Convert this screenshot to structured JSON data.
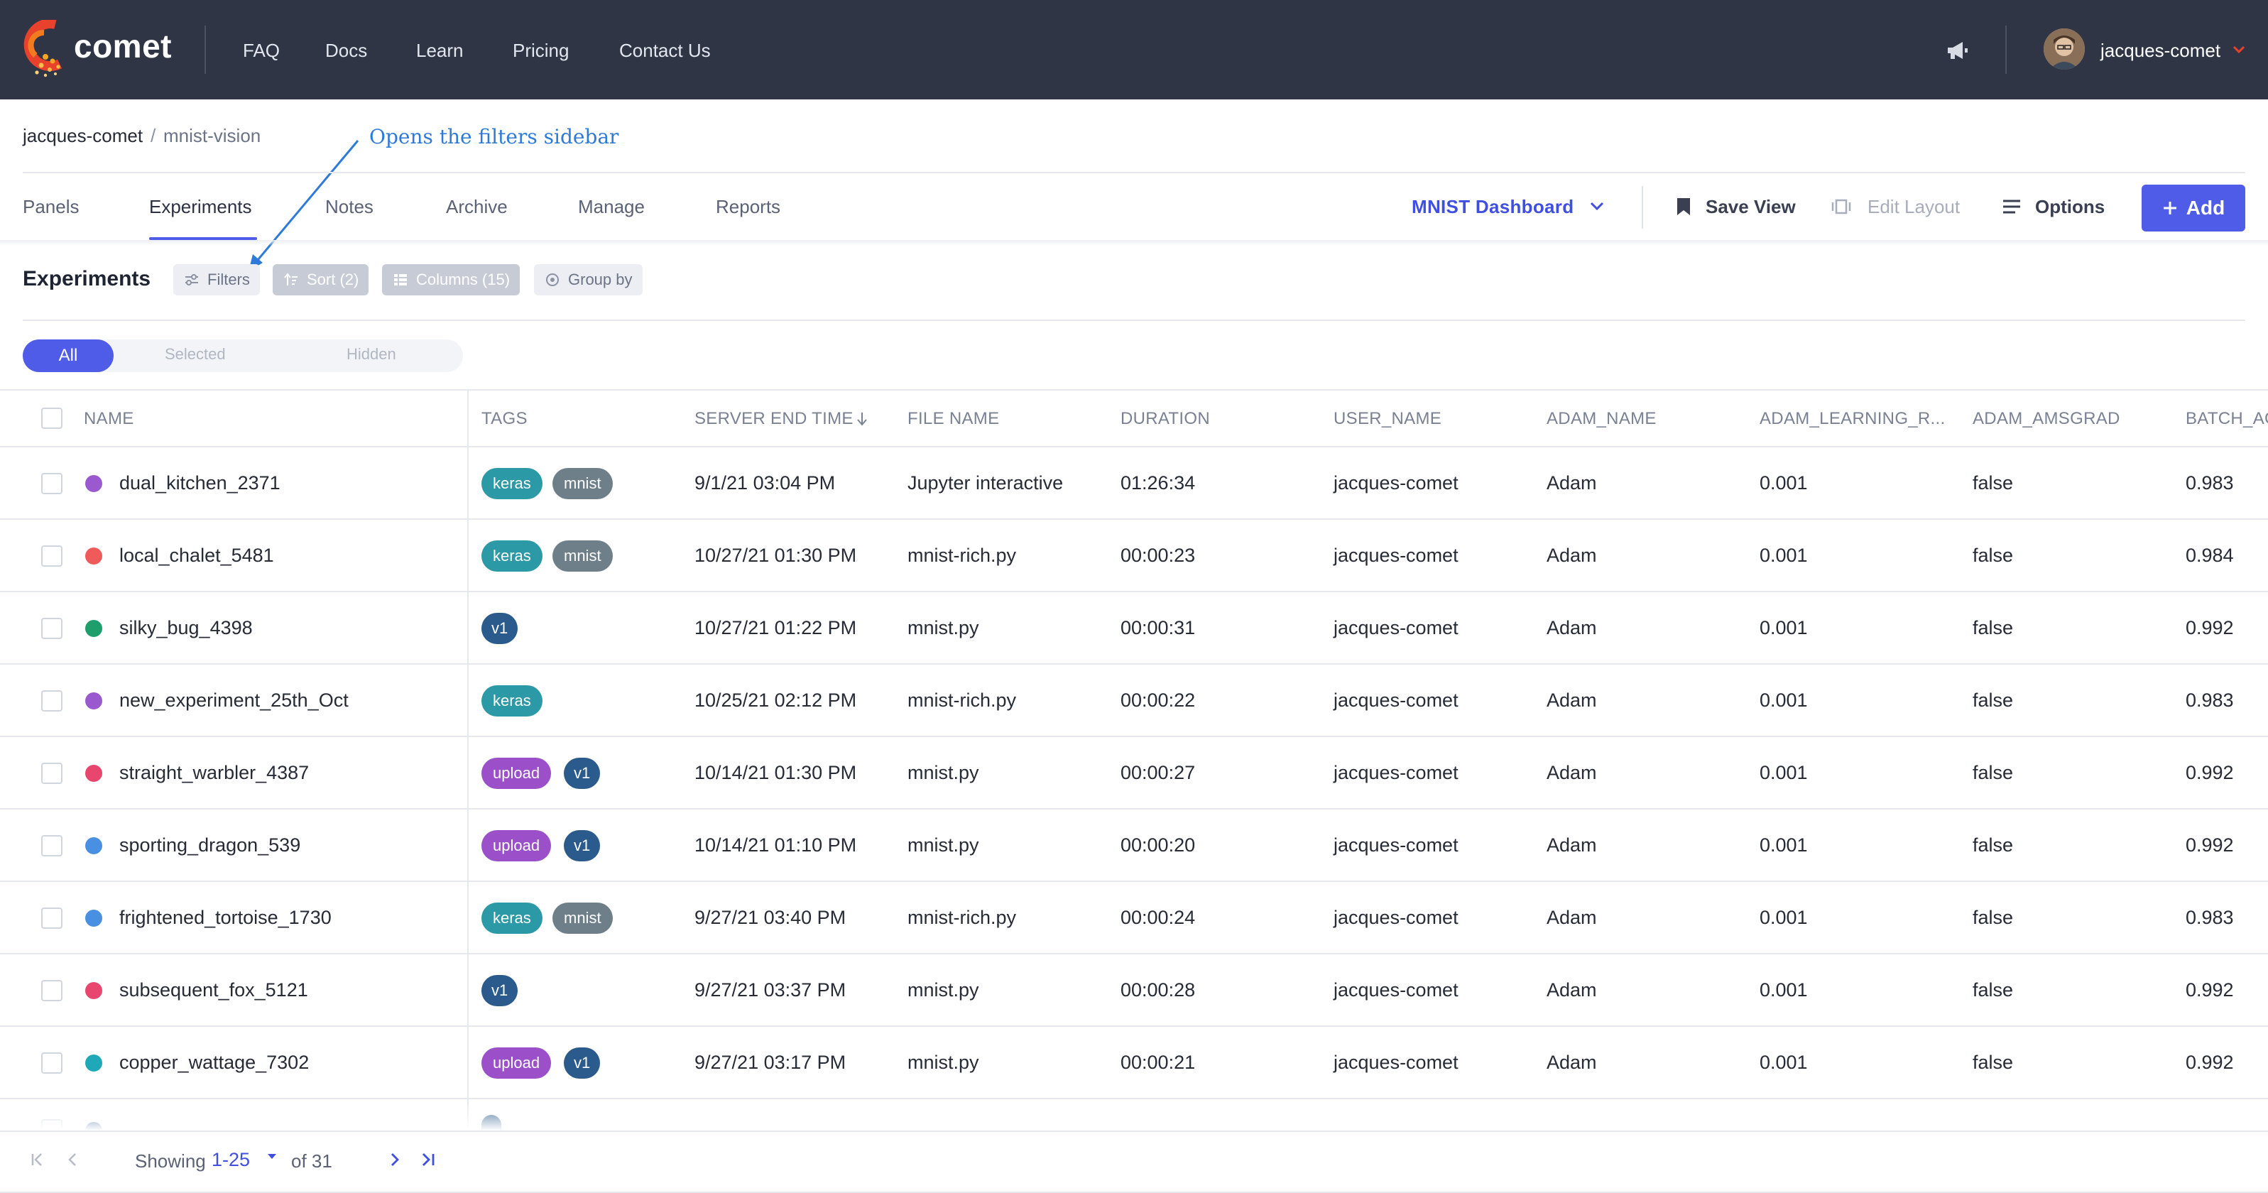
{
  "brand": {
    "name": "comet"
  },
  "nav": {
    "items": [
      "FAQ",
      "Docs",
      "Learn",
      "Pricing",
      "Contact Us"
    ]
  },
  "user": {
    "name": "jacques-comet"
  },
  "breadcrumb": {
    "owner": "jacques-comet",
    "separator": "/",
    "project": "mnist-vision"
  },
  "annotation": {
    "text": "Opens the filters sidebar"
  },
  "tabs": [
    "Panels",
    "Experiments",
    "Notes",
    "Archive",
    "Manage",
    "Reports"
  ],
  "active_tab": "Experiments",
  "toolbar": {
    "dashboard": "MNIST Dashboard",
    "save_view": "Save View",
    "edit_layout": "Edit Layout",
    "options": "Options",
    "add": "Add"
  },
  "experiments": {
    "title": "Experiments",
    "filters": "Filters",
    "sort": "Sort (2)",
    "columns": "Columns (15)",
    "group_by": "Group by"
  },
  "segments": {
    "all": "All",
    "selected": "Selected",
    "hidden": "Hidden"
  },
  "columns": [
    "NAME",
    "TAGS",
    "SERVER END TIME",
    "FILE NAME",
    "DURATION",
    "USER_NAME",
    "ADAM_NAME",
    "ADAM_LEARNING_R...",
    "ADAM_AMSGRAD",
    "BATCH_AC"
  ],
  "rows": [
    {
      "name": "dual_kitchen_2371",
      "color": "#9b59d0",
      "tags": [
        "keras",
        "mnist"
      ],
      "end_time": "9/1/21 03:04 PM",
      "file": "Jupyter interactive",
      "duration": "01:26:34",
      "user": "jacques-comet",
      "adam": "Adam",
      "lr": "0.001",
      "amsgrad": "false",
      "batch": "0.983"
    },
    {
      "name": "local_chalet_5481",
      "color": "#ef5b5b",
      "tags": [
        "keras",
        "mnist"
      ],
      "end_time": "10/27/21 01:30 PM",
      "file": "mnist-rich.py",
      "duration": "00:00:23",
      "user": "jacques-comet",
      "adam": "Adam",
      "lr": "0.001",
      "amsgrad": "false",
      "batch": "0.984"
    },
    {
      "name": "silky_bug_4398",
      "color": "#1e9e6a",
      "tags": [
        "v1"
      ],
      "end_time": "10/27/21 01:22 PM",
      "file": "mnist.py",
      "duration": "00:00:31",
      "user": "jacques-comet",
      "adam": "Adam",
      "lr": "0.001",
      "amsgrad": "false",
      "batch": "0.992"
    },
    {
      "name": "new_experiment_25th_Oct",
      "color": "#9b59d0",
      "tags": [
        "keras"
      ],
      "end_time": "10/25/21 02:12 PM",
      "file": "mnist-rich.py",
      "duration": "00:00:22",
      "user": "jacques-comet",
      "adam": "Adam",
      "lr": "0.001",
      "amsgrad": "false",
      "batch": "0.983"
    },
    {
      "name": "straight_warbler_4387",
      "color": "#e8466e",
      "tags": [
        "upload",
        "v1"
      ],
      "end_time": "10/14/21 01:30 PM",
      "file": "mnist.py",
      "duration": "00:00:27",
      "user": "jacques-comet",
      "adam": "Adam",
      "lr": "0.001",
      "amsgrad": "false",
      "batch": "0.992"
    },
    {
      "name": "sporting_dragon_539",
      "color": "#4a90e2",
      "tags": [
        "upload",
        "v1"
      ],
      "end_time": "10/14/21 01:10 PM",
      "file": "mnist.py",
      "duration": "00:00:20",
      "user": "jacques-comet",
      "adam": "Adam",
      "lr": "0.001",
      "amsgrad": "false",
      "batch": "0.992"
    },
    {
      "name": "frightened_tortoise_1730",
      "color": "#4a90e2",
      "tags": [
        "keras",
        "mnist"
      ],
      "end_time": "9/27/21 03:40 PM",
      "file": "mnist-rich.py",
      "duration": "00:00:24",
      "user": "jacques-comet",
      "adam": "Adam",
      "lr": "0.001",
      "amsgrad": "false",
      "batch": "0.983"
    },
    {
      "name": "subsequent_fox_5121",
      "color": "#e8466e",
      "tags": [
        "v1"
      ],
      "end_time": "9/27/21 03:37 PM",
      "file": "mnist.py",
      "duration": "00:00:28",
      "user": "jacques-comet",
      "adam": "Adam",
      "lr": "0.001",
      "amsgrad": "false",
      "batch": "0.992"
    },
    {
      "name": "copper_wattage_7302",
      "color": "#1fa8b8",
      "tags": [
        "upload",
        "v1"
      ],
      "end_time": "9/27/21 03:17 PM",
      "file": "mnist.py",
      "duration": "00:00:21",
      "user": "jacques-comet",
      "adam": "Adam",
      "lr": "0.001",
      "amsgrad": "false",
      "batch": "0.992"
    }
  ],
  "pager": {
    "showing": "Showing",
    "range": "1-25",
    "of": "of 31"
  },
  "colors": {
    "accent": "#4f5ce8",
    "topbar": "#2f3544"
  }
}
